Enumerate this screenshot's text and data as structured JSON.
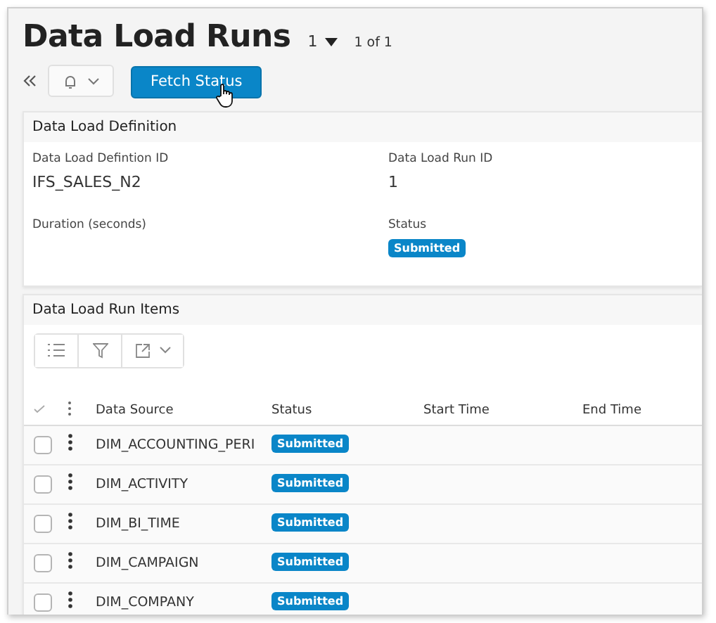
{
  "page": {
    "title": "Data Load Runs",
    "record_selector": "1",
    "record_count": "1 of 1"
  },
  "toolbar": {
    "primary_button": "Fetch Status"
  },
  "definition": {
    "header": "Data Load Definition",
    "fields": [
      {
        "label": "Data Load Defintion ID",
        "value": "IFS_SALES_N2",
        "kind": "text"
      },
      {
        "label": "Data Load Run ID",
        "value": "1",
        "kind": "text"
      },
      {
        "label": "Duration (seconds)"
      },
      {
        "label": "Status",
        "value": "Submitted",
        "kind": "badge"
      }
    ]
  },
  "items": {
    "header": "Data Load Run Items",
    "columns": [
      "Data Source",
      "Status",
      "Start Time",
      "End Time"
    ],
    "rows": [
      {
        "data_source": "DIM_ACCOUNTING_PERI",
        "status": "Submitted",
        "checked": false
      },
      {
        "data_source": "DIM_ACTIVITY",
        "status": "Submitted",
        "checked": false
      },
      {
        "data_source": "DIM_BI_TIME",
        "status": "Submitted",
        "checked": false
      },
      {
        "data_source": "DIM_CAMPAIGN",
        "status": "Submitted",
        "checked": false
      },
      {
        "data_source": "DIM_COMPANY",
        "status": "Submitted",
        "checked": false
      }
    ]
  }
}
